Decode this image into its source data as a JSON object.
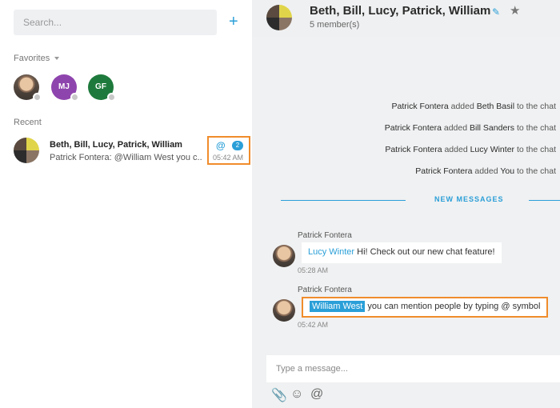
{
  "sidebar": {
    "search_placeholder": "Search...",
    "add_label": "+",
    "favorites_label": "Favorites",
    "favorites": [
      {
        "initials": "",
        "color": "#5a4a3f"
      },
      {
        "initials": "MJ",
        "color": "#8e44ad"
      },
      {
        "initials": "GF",
        "color": "#1e7a3c"
      }
    ],
    "recent_label": "Recent",
    "conversation": {
      "title": "Beth, Bill, Lucy, Patrick, William",
      "snippet": "Patrick Fontera: @William West you c...",
      "at": "@",
      "badge": "2",
      "time": "05:42 AM"
    }
  },
  "chat": {
    "title": "Beth, Bill, Lucy, Patrick, William",
    "members": "5 member(s)",
    "system_messages": [
      {
        "actor": "Patrick Fontera",
        "verb": "added",
        "target": "Beth Basil",
        "suffix": "to the chat"
      },
      {
        "actor": "Patrick Fontera",
        "verb": "added",
        "target": "Bill Sanders",
        "suffix": "to the chat"
      },
      {
        "actor": "Patrick Fontera",
        "verb": "added",
        "target": "Lucy Winter",
        "suffix": "to the chat"
      },
      {
        "actor": "Patrick Fontera",
        "verb": "added",
        "target": "You",
        "suffix": "to the chat"
      }
    ],
    "new_messages_label": "NEW MESSAGES",
    "messages": [
      {
        "sender": "Patrick Fontera",
        "mention": "Lucy Winter",
        "text": " Hi! Check out our new chat feature!",
        "time": "05:28 AM"
      },
      {
        "sender": "Patrick Fontera",
        "mention": "William West",
        "text": " you can mention people by typing @ symbol",
        "time": "05:42 AM"
      }
    ],
    "composer_placeholder": "Type a message..."
  },
  "colors": {
    "accent": "#2a9fd8",
    "highlight_border": "#f08c2b"
  },
  "icons": [
    "plus-icon",
    "chevron-down-icon",
    "edit-icon",
    "star-icon",
    "attach-icon",
    "emoji-icon",
    "mention-icon"
  ]
}
